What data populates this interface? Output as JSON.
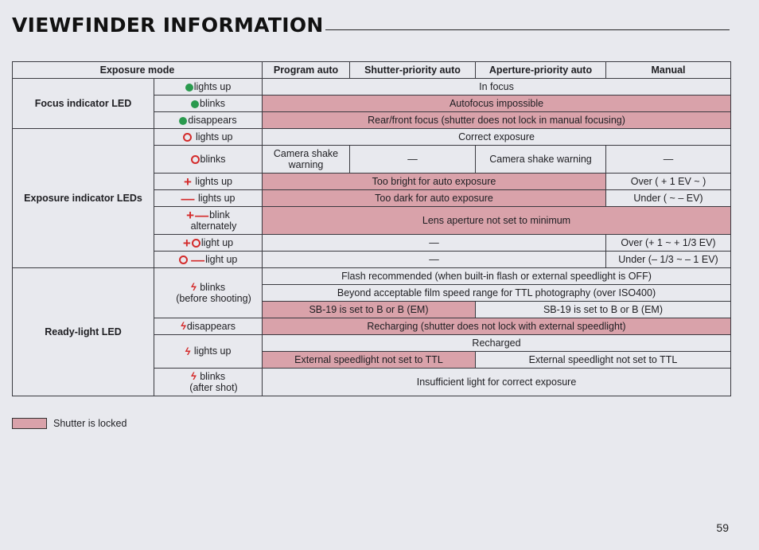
{
  "page_title": "VIEWFINDER INFORMATION",
  "page_number": "59",
  "colors": {
    "shutter_locked": "#d9a2aa",
    "focus_led": "#2a9a4e",
    "exposure_led": "#d42b2b"
  },
  "icons": {
    "focus_dot": "●",
    "exposure_circle": "○",
    "plus": "+",
    "minus": "—",
    "flash_bolt": "ϟ"
  },
  "table": {
    "header": {
      "exposure_mode": "Exposure mode",
      "program_auto": "Program auto",
      "shutter_priority_auto": "Shutter-priority auto",
      "aperture_priority_auto": "Aperture-priority auto",
      "manual": "Manual"
    },
    "focus": {
      "label": "Focus indicator LED",
      "rows": [
        {
          "condition": "lights up",
          "value": "In focus",
          "locked": false
        },
        {
          "condition": "blinks",
          "value": "Autofocus impossible",
          "locked": true
        },
        {
          "condition": "disappears",
          "value": "Rear/front focus (shutter does not lock in manual focusing)",
          "locked": true
        }
      ]
    },
    "exposure": {
      "label": "Exposure indicator LEDs",
      "rows": [
        {
          "condition": "lights up",
          "value": "Correct exposure"
        },
        {
          "condition": "blinks",
          "program": "Camera shake warning",
          "shutter": "—",
          "aperture": "Camera shake warning",
          "manual": "—"
        },
        {
          "condition": "lights up",
          "auto": "Too bright for auto exposure",
          "manual": "Over ( + 1 EV ~ )"
        },
        {
          "condition": "lights up",
          "auto": "Too dark for auto exposure",
          "manual": "Under ( ~ – EV)"
        },
        {
          "condition": "blink",
          "condition_sub": "alternately",
          "value": "Lens aperture not set to minimum"
        },
        {
          "condition": "light up",
          "auto": "—",
          "manual": "Over (+ 1 ~ + 1/3 EV)"
        },
        {
          "condition": "light up",
          "auto": "—",
          "manual": "Under (– 1/3 ~ – 1 EV)"
        }
      ]
    },
    "ready": {
      "label": "Ready-light LED",
      "rows": [
        {
          "condition": "blinks",
          "condition_sub": "(before shooting)"
        },
        {
          "condition": "disappears",
          "value": "Recharging (shutter does not lock with external speedlight)"
        },
        {
          "condition": "lights up"
        },
        {
          "condition": "blinks",
          "condition_sub": "(after shot)",
          "value": "Insufficient light for correct exposure"
        }
      ],
      "flash_recommended": "Flash recommended (when built-in flash or external speedlight is OFF)",
      "beyond_range": "Beyond acceptable film speed range for TTL photography (over ISO400)",
      "sb19_locked": "SB-19 is set to B or B (EM)",
      "sb19_unlocked": "SB-19 is set to B or B (EM)",
      "recharged": "Recharged",
      "not_ttl_locked": "External speedlight not set to TTL",
      "not_ttl_unlocked": "External speedlight not set to TTL"
    }
  },
  "legend": {
    "label": "Shutter is locked"
  }
}
